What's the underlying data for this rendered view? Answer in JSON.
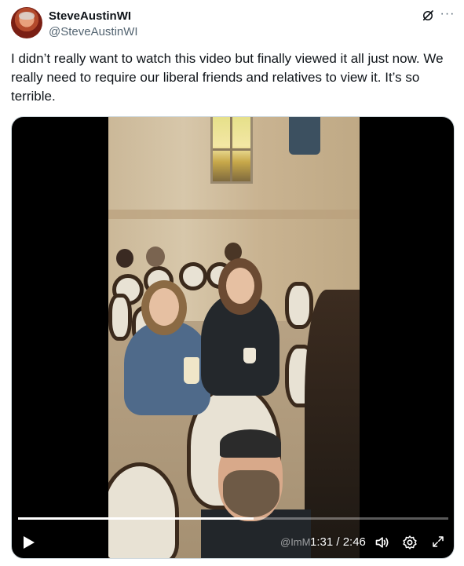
{
  "author": {
    "display_name": "SteveAustinWI",
    "handle": "@SteveAustinWI"
  },
  "header_icons": [
    "grok-icon",
    "more-icon"
  ],
  "more_label": "···",
  "tweet": {
    "text": "I didn’t really want to watch this video but finally viewed it all just now. We really need to require our liberal friends and relatives to view it. It’s so terrible."
  },
  "video": {
    "current_time": "1:31",
    "duration": "2:46",
    "time_display": "1:31 / 2:46",
    "progress": 0.548,
    "watermark": "@ImM",
    "controls": [
      "play-icon",
      "volume-icon",
      "settings-icon",
      "expand-icon"
    ]
  },
  "colors": {
    "text_primary": "#0f1419",
    "text_secondary": "#536471",
    "media_border": "#cfd9de",
    "video_bg": "#000000"
  }
}
